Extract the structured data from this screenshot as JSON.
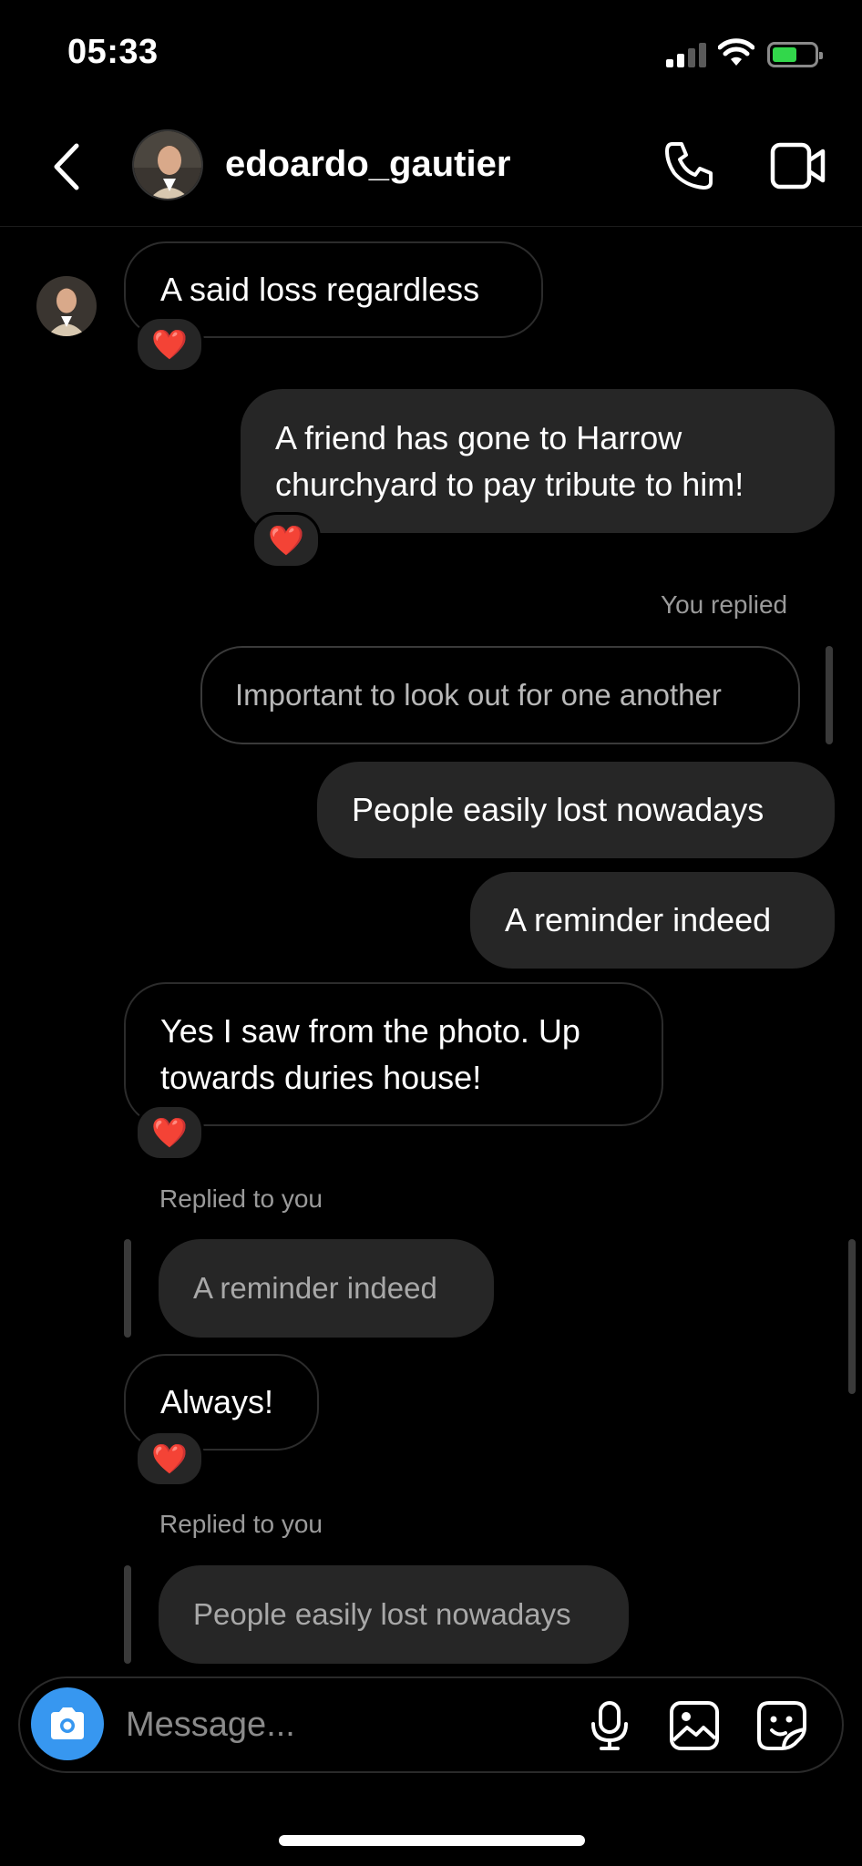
{
  "status": {
    "time": "05:33"
  },
  "header": {
    "username": "edoardo_gautier"
  },
  "messages": {
    "m1": "A said loss regardless",
    "m2": "A friend has gone to Harrow churchyard to pay tribute to him!",
    "m3_label": "You replied",
    "m3_quote": "Important to look out for one another",
    "m4": "People easily lost nowadays",
    "m5": "A reminder indeed",
    "m6": "Yes I saw from the photo. Up towards duries house!",
    "m7_label": "Replied to you",
    "m7_quote": "A reminder indeed",
    "m8": "Always!",
    "m9_label": "Replied to you",
    "m9_quote": "People easily lost nowadays"
  },
  "reaction": "❤️",
  "composer": {
    "placeholder": "Message..."
  },
  "icons": {
    "back": "chevron-left-icon",
    "call": "phone-icon",
    "video": "video-camera-icon",
    "camera": "camera-icon",
    "mic": "microphone-icon",
    "gallery": "image-icon",
    "sticker": "sticker-icon"
  },
  "colors": {
    "accent": "#3797f0",
    "bubble_out": "#262626",
    "reaction": "#ff2d3f"
  }
}
